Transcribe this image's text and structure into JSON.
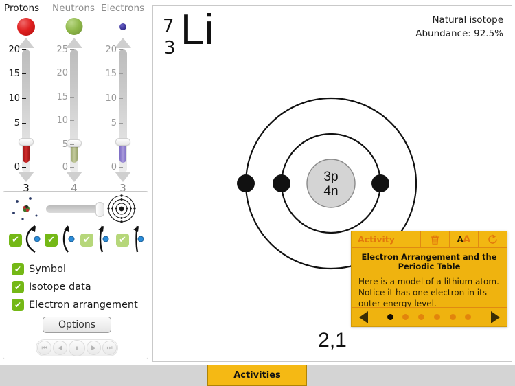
{
  "sliders": [
    {
      "name": "Protons",
      "value": "3",
      "max": 20,
      "ticks": [
        "20",
        "15",
        "10",
        "5",
        "0"
      ],
      "active": true
    },
    {
      "name": "Neutrons",
      "value": "4",
      "max": 25,
      "ticks": [
        "25",
        "20",
        "15",
        "10",
        "5",
        "0"
      ],
      "active": false
    },
    {
      "name": "Electrons",
      "value": "3",
      "max": 20,
      "ticks": [
        "20",
        "15",
        "10",
        "5",
        "0"
      ],
      "active": false
    }
  ],
  "controls": {
    "orbit_options": [
      {
        "checked": true,
        "dim": false
      },
      {
        "checked": true,
        "dim": false
      },
      {
        "checked": true,
        "dim": true
      },
      {
        "checked": true,
        "dim": true
      }
    ],
    "check_mark": "✔",
    "display_options": [
      {
        "label": "Symbol",
        "checked": true
      },
      {
        "label": "Isotope data",
        "checked": true
      },
      {
        "label": "Electron arrangement",
        "checked": true
      }
    ],
    "options_button": "Options",
    "playback": [
      {
        "icon": "⏮",
        "name": "skip-back"
      },
      {
        "icon": "◀",
        "name": "step-back"
      },
      {
        "icon": "⏸",
        "name": "pause"
      },
      {
        "icon": "▶",
        "name": "step-forward"
      },
      {
        "icon": "⏭",
        "name": "skip-forward"
      }
    ]
  },
  "stage": {
    "mass_number": "7",
    "atomic_number": "3",
    "element_symbol": "Li",
    "isotope_line1": "Natural isotope",
    "isotope_line2": "Abundance: 92.5%",
    "nucleus_protons": "3p",
    "nucleus_neutrons": "4n",
    "electron_arrangement": "2,1"
  },
  "activity": {
    "header_label": "Activity",
    "toolbar": [
      {
        "name": "delete-icon",
        "kind": "trash"
      },
      {
        "name": "text-size-icon",
        "kind": "aa"
      },
      {
        "name": "reset-icon",
        "kind": "refresh"
      }
    ],
    "title": "Electron Arrangement and the Periodic Table",
    "body": "Here is a model of a lithium atom. Notice it has one electron in its outer energy level.",
    "dots": [
      {
        "active": true
      },
      {
        "active": false
      },
      {
        "active": false
      },
      {
        "active": false
      },
      {
        "active": false
      },
      {
        "active": false
      }
    ]
  },
  "bottom": {
    "activities_tab": "Activities"
  },
  "colors": {
    "proton": "#e02020",
    "neutron": "#8fb84a",
    "electron": "#3b3496",
    "accent_amber": "#efb30f",
    "accent_orange": "#e2780c",
    "check_green": "#74b816"
  }
}
